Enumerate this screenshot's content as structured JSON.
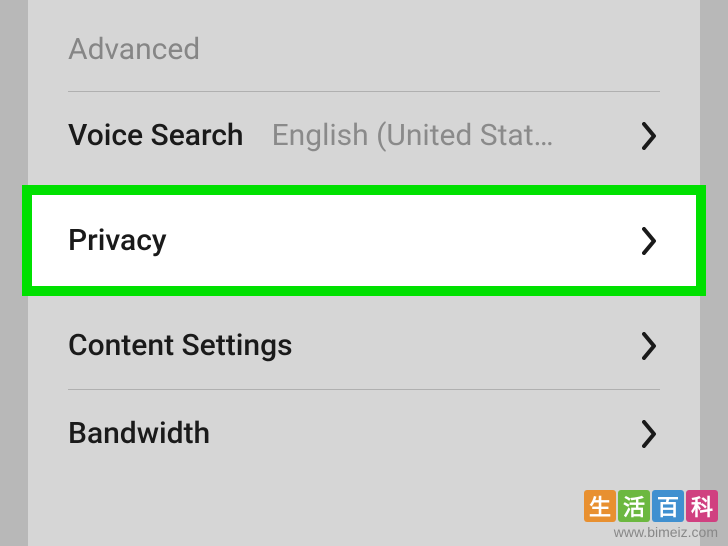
{
  "section": {
    "header": "Advanced"
  },
  "items": {
    "voice_search": {
      "label": "Voice Search",
      "value": "English (United Stat…"
    },
    "privacy": {
      "label": "Privacy"
    },
    "content_settings": {
      "label": "Content Settings"
    },
    "bandwidth": {
      "label": "Bandwidth"
    }
  },
  "watermark": {
    "chars": [
      "生",
      "活",
      "百",
      "科"
    ],
    "url": "www.bimeiz.com"
  }
}
